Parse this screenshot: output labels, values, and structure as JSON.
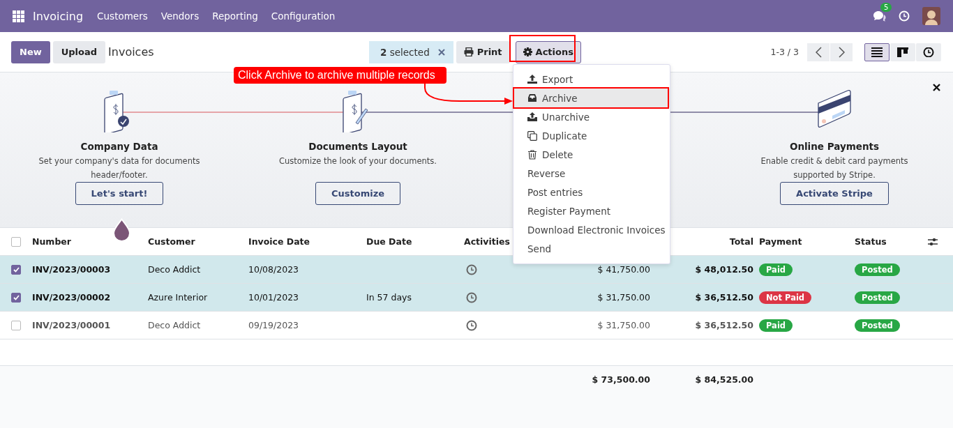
{
  "navbar": {
    "brand": "Invoicing",
    "menu": [
      "Customers",
      "Vendors",
      "Reporting",
      "Configuration"
    ],
    "chat_badge": "5"
  },
  "control_panel": {
    "buttons": [
      "New",
      "Upload"
    ],
    "breadcrumb": "Invoices",
    "selection": "**2** selected",
    "print": "Print",
    "actions": {
      "label": "Actions",
      "open": true
    },
    "pager": "1-3 / 3",
    "views": [
      {
        "kind": "list",
        "selected": true
      },
      {
        "kind": "kanban",
        "selected": false
      },
      {
        "kind": "activity",
        "selected": false
      }
    ]
  },
  "onboarding": {
    "steps": [
      {
        "kind": "company",
        "title": "Company Data",
        "description": "Set your company's data for documents header/footer.",
        "button": "Let's start!"
      },
      {
        "kind": "layout",
        "title": "Documents Layout",
        "description": "Customize the look of your documents.",
        "button": "Customize"
      },
      {
        "kind": "payment",
        "title": "Online Payments",
        "description": "Enable credit & debit card payments supported by Stripe.",
        "button": "Activate Stripe"
      }
    ]
  },
  "table": {
    "all_selected": false,
    "columns": [
      "Number",
      "Customer",
      "Invoice Date",
      "Due Date",
      "Activities",
      null,
      "Total",
      "Payment",
      "Status"
    ],
    "rows": [
      {
        "selected": true,
        "number": "INV/2023/00003",
        "customer": "Deco Addict",
        "invoice_date": "10/08/2023",
        "due_date": "",
        "column_6": "$ 41,750.00",
        "total": "$ 48,012.50",
        "payment": {
          "label": "Paid",
          "color": "#28a745"
        },
        "status": {
          "label": "Posted",
          "color": "#28a745"
        }
      },
      {
        "selected": true,
        "number": "INV/2023/00002",
        "customer": "Azure Interior",
        "invoice_date": "10/01/2023",
        "due_date": "In 57 days",
        "column_6": "$ 31,750.00",
        "total": "$ 36,512.50",
        "payment": {
          "label": "Not Paid",
          "color": "#dc3545"
        },
        "status": {
          "label": "Posted",
          "color": "#28a745"
        }
      },
      {
        "selected": false,
        "number": "INV/2023/00001",
        "customer": "Deco Addict",
        "invoice_date": "09/19/2023",
        "due_date": "",
        "column_6": "$ 31,750.00",
        "total": "$ 36,512.50",
        "payment": {
          "label": "Paid",
          "color": "#28a745"
        },
        "status": {
          "label": "Posted",
          "color": "#28a745"
        }
      }
    ],
    "footer": {
      "column_6": "$ 73,500.00",
      "total": "$ 84,525.00"
    }
  },
  "actions_menu": [
    {
      "kind": "export",
      "label": "Export",
      "highlighted": false
    },
    {
      "kind": "archive",
      "label": "Archive",
      "highlighted": true
    },
    {
      "kind": "unarchive",
      "label": "Unarchive",
      "highlighted": false
    },
    {
      "kind": "duplicate",
      "label": "Duplicate",
      "highlighted": false
    },
    {
      "kind": "delete",
      "label": "Delete",
      "highlighted": false
    },
    {
      "kind": "plain",
      "label": "Reverse",
      "highlighted": false
    },
    {
      "kind": "plain",
      "label": "Post entries",
      "highlighted": false
    },
    {
      "kind": "plain",
      "label": "Register Payment",
      "highlighted": false
    },
    {
      "kind": "plain",
      "label": "Download Electronic Invoices",
      "highlighted": false
    },
    {
      "kind": "plain",
      "label": "Send",
      "highlighted": false
    }
  ],
  "annotation": {
    "text": "Click Archive to archive multiple records"
  }
}
